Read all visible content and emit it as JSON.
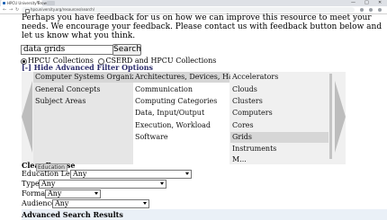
{
  "browser": {
    "tab_title": "HPCU University Browse",
    "url": "hpcuniversity.org/resources/search/",
    "window_controls": [
      "—",
      "□",
      "✕"
    ]
  },
  "page": {
    "intro_text": "Perhaps you have feedback for us on how we can improve this resource to meet your needs. We encourage your feedback. Please contact us with feedback button below and let us know what you think.",
    "search": {
      "value": "data grids",
      "button_label": "Search"
    },
    "collections": [
      {
        "label": "HPCU Collections",
        "selected": true
      },
      {
        "label": "CSERD and HPCU Collections",
        "selected": false
      }
    ],
    "hide_filters_label": "[-] Hide Advanced Filter Options",
    "filter_columns": {
      "col1": [
        "Computer Systems Organization",
        "General Concepts",
        "Subject Areas"
      ],
      "col2": [
        "Architectures, Devices, Hardware",
        "Communication",
        "Computing Categories",
        "Data, Input/Output",
        "Execution, Workload",
        "Software"
      ],
      "col3": [
        "Accelerators",
        "Clouds",
        "Clusters",
        "Computers",
        "Cores",
        "Grids",
        "Instruments",
        "M..."
      ]
    },
    "selected": {
      "col1": "Computer Systems Organization",
      "col2": "Architectures, Devices, Hardware",
      "col3": "Grids"
    },
    "clear_label": "Clear Browse",
    "tooltip_label": "Education",
    "filters": {
      "education_level": {
        "label": "Education Level:",
        "value": "Any"
      },
      "type": {
        "label": "Type:",
        "value": "Any"
      },
      "format": {
        "label": "Format:",
        "value": "Any"
      },
      "audience": {
        "label": "Audience:",
        "value": "Any"
      }
    },
    "advanced_results_heading": "Advanced Search Results"
  }
}
